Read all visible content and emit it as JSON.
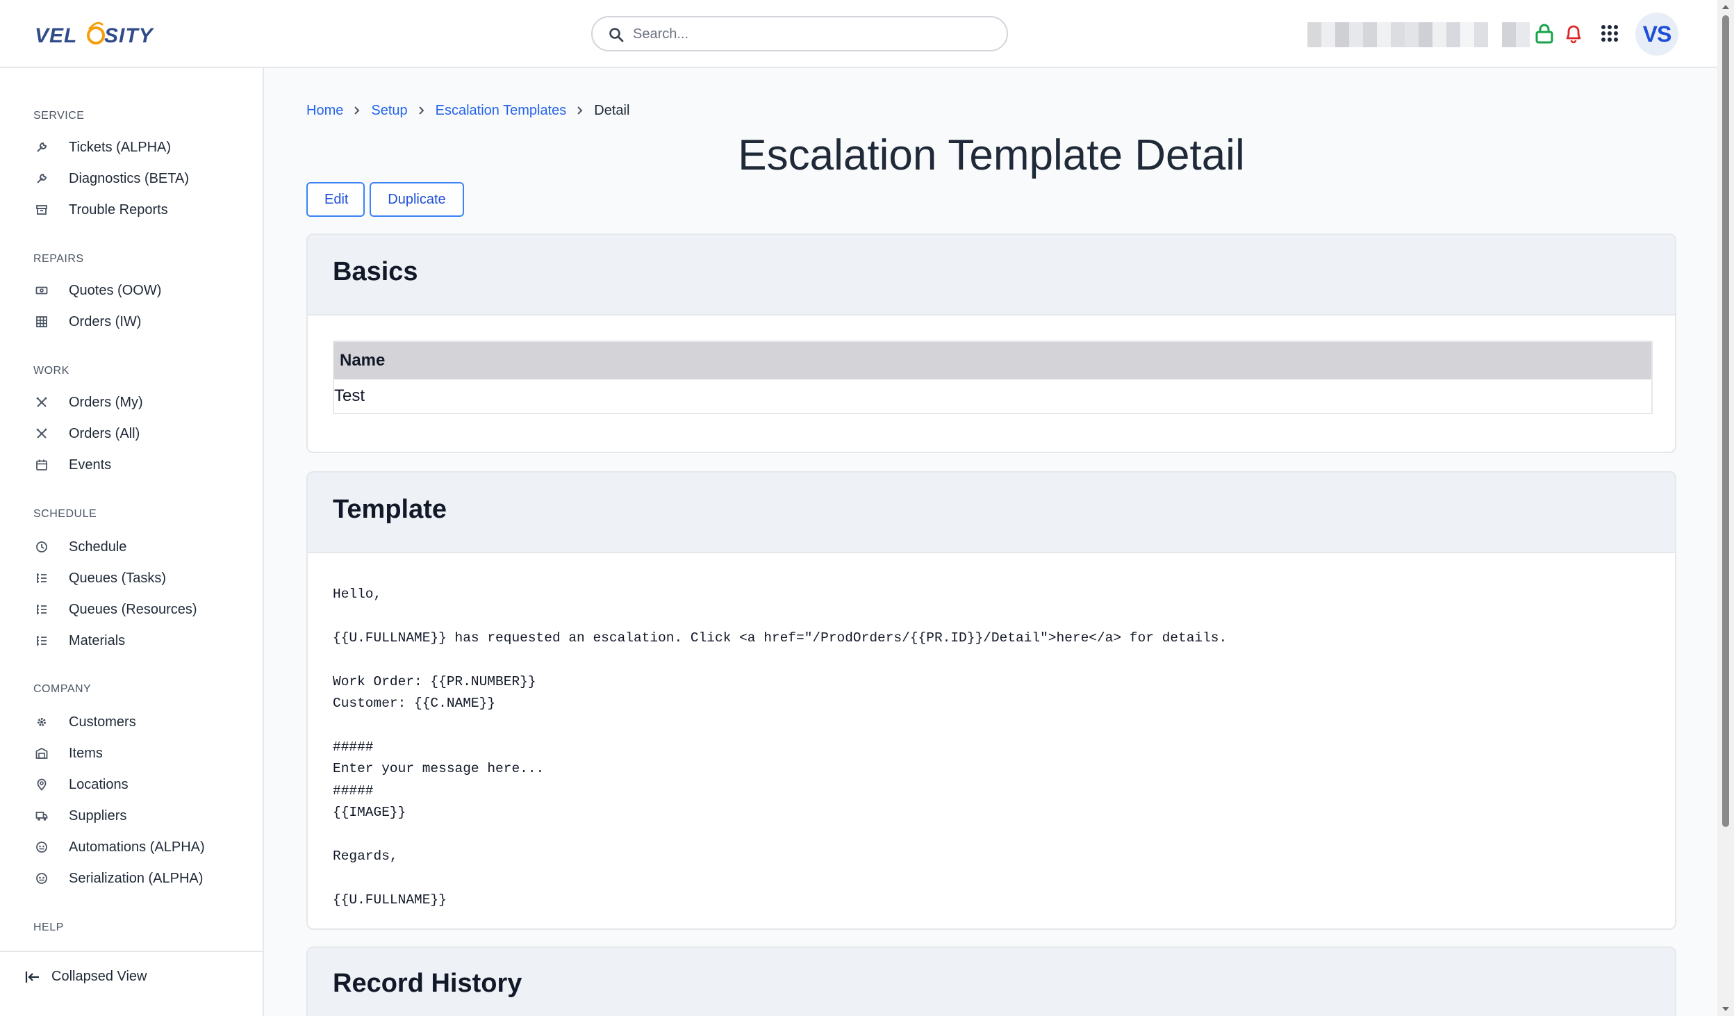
{
  "header": {
    "logo_text": "VELOSITY",
    "search_placeholder": "Search...",
    "avatar_initials": "VS",
    "colors": {
      "lock": "#16a34a",
      "bell": "#dc2626",
      "accent": "#2563eb"
    }
  },
  "sidebar": {
    "sections": [
      {
        "title": "SERVICE",
        "items": [
          {
            "label": "Tickets (ALPHA)",
            "icon": "wrench-icon"
          },
          {
            "label": "Diagnostics (BETA)",
            "icon": "wrench-icon"
          },
          {
            "label": "Trouble Reports",
            "icon": "archive-icon"
          }
        ]
      },
      {
        "title": "REPAIRS",
        "items": [
          {
            "label": "Quotes (OOW)",
            "icon": "money-icon"
          },
          {
            "label": "Orders (IW)",
            "icon": "grid-icon"
          }
        ]
      },
      {
        "title": "WORK",
        "items": [
          {
            "label": "Orders (My)",
            "icon": "tools-icon"
          },
          {
            "label": "Orders (All)",
            "icon": "tools-icon"
          },
          {
            "label": "Events",
            "icon": "calendar-icon"
          }
        ]
      },
      {
        "title": "SCHEDULE",
        "items": [
          {
            "label": "Schedule",
            "icon": "clock-icon"
          },
          {
            "label": "Queues (Tasks)",
            "icon": "list-icon"
          },
          {
            "label": "Queues (Resources)",
            "icon": "list-icon"
          },
          {
            "label": "Materials",
            "icon": "list-icon"
          }
        ]
      },
      {
        "title": "COMPANY",
        "items": [
          {
            "label": "Customers",
            "icon": "cog-icon"
          },
          {
            "label": "Items",
            "icon": "warehouse-icon"
          },
          {
            "label": "Locations",
            "icon": "pin-icon"
          },
          {
            "label": "Suppliers",
            "icon": "truck-icon"
          },
          {
            "label": "Automations (ALPHA)",
            "icon": "robot-icon"
          },
          {
            "label": "Serialization (ALPHA)",
            "icon": "robot-icon"
          }
        ]
      },
      {
        "title": "HELP",
        "items": []
      }
    ],
    "collapse_label": "Collapsed View"
  },
  "breadcrumb": {
    "items": [
      "Home",
      "Setup",
      "Escalation Templates"
    ],
    "current": "Detail"
  },
  "page": {
    "title": "Escalation Template Detail",
    "edit_label": "Edit",
    "duplicate_label": "Duplicate"
  },
  "basics": {
    "title": "Basics",
    "name_header": "Name",
    "name_value": "Test"
  },
  "template": {
    "title": "Template",
    "body": "Hello,\n\n{{U.FULLNAME}} has requested an escalation. Click <a href=\"/ProdOrders/{{PR.ID}}/Detail\">here</a> for details.\n\nWork Order: {{PR.NUMBER}}\nCustomer: {{C.NAME}}\n\n#####\nEnter your message here...\n#####\n{{IMAGE}}\n\nRegards,\n\n{{U.FULLNAME}}"
  },
  "record_history": {
    "title": "Record History"
  }
}
